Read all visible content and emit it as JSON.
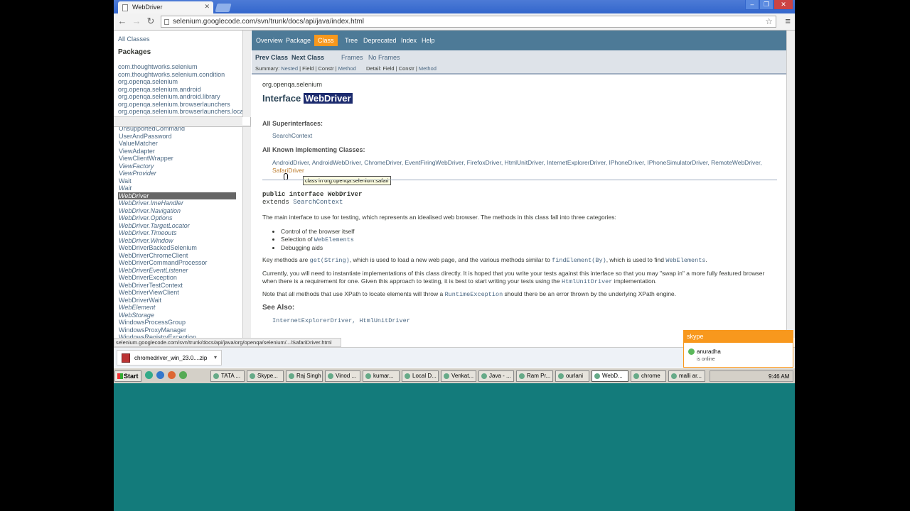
{
  "browser": {
    "tab_title": "WebDriver",
    "url": "selenium.googlecode.com/svn/trunk/docs/api/java/index.html"
  },
  "left_top": {
    "all_classes": "All Classes",
    "packages_heading": "Packages",
    "packages": [
      "com.thoughtworks.selenium",
      "com.thoughtworks.selenium.condition",
      "org.openqa.selenium",
      "org.openqa.selenium.android",
      "org.openqa.selenium.android.library",
      "org.openqa.selenium.browserlaunchers",
      "org.openqa.selenium.browserlaunchers.loca"
    ]
  },
  "class_list": [
    {
      "name": "UnsupportedCommand",
      "italic": false
    },
    {
      "name": "UserAndPassword",
      "italic": false
    },
    {
      "name": "ValueMatcher",
      "italic": false
    },
    {
      "name": "ViewAdapter",
      "italic": false
    },
    {
      "name": "ViewClientWrapper",
      "italic": false
    },
    {
      "name": "ViewFactory",
      "italic": true
    },
    {
      "name": "ViewProvider",
      "italic": true
    },
    {
      "name": "Wait",
      "italic": false
    },
    {
      "name": "Wait",
      "italic": true
    },
    {
      "name": "WebDriver",
      "italic": true,
      "selected": true
    },
    {
      "name": "WebDriver.ImeHandler",
      "italic": true
    },
    {
      "name": "WebDriver.Navigation",
      "italic": true
    },
    {
      "name": "WebDriver.Options",
      "italic": true
    },
    {
      "name": "WebDriver.TargetLocator",
      "italic": true
    },
    {
      "name": "WebDriver.Timeouts",
      "italic": true
    },
    {
      "name": "WebDriver.Window",
      "italic": true
    },
    {
      "name": "WebDriverBackedSelenium",
      "italic": false
    },
    {
      "name": "WebDriverChromeClient",
      "italic": false
    },
    {
      "name": "WebDriverCommandProcessor",
      "italic": false
    },
    {
      "name": "WebDriverEventListener",
      "italic": true
    },
    {
      "name": "WebDriverException",
      "italic": false
    },
    {
      "name": "WebDriverTestContext",
      "italic": false
    },
    {
      "name": "WebDriverViewClient",
      "italic": false
    },
    {
      "name": "WebDriverWait",
      "italic": false
    },
    {
      "name": "WebElement",
      "italic": true
    },
    {
      "name": "WebStorage",
      "italic": true
    },
    {
      "name": "WindowsProcessGroup",
      "italic": false
    },
    {
      "name": "WindowsProxyManager",
      "italic": false
    },
    {
      "name": "WindowsRegistryException",
      "italic": false
    }
  ],
  "topnav": {
    "overview": "Overview",
    "package": "Package",
    "class": "Class",
    "tree": "Tree",
    "deprecated": "Deprecated",
    "index": "Index",
    "help": "Help"
  },
  "subnav": {
    "prev_class": "Prev Class",
    "next_class": "Next Class",
    "frames": "Frames",
    "no_frames": "No Frames",
    "summary_label": "Summary: ",
    "summary_nested": "Nested",
    "summary_rest": " | Field | Constr | ",
    "summary_method": "Method",
    "detail_label": "Detail: Field | Constr | ",
    "detail_method": "Method"
  },
  "content": {
    "package": "org.openqa.selenium",
    "title_prefix": "Interface ",
    "title_name": "WebDriver",
    "superinterfaces_label": "All Superinterfaces:",
    "superinterfaces": "SearchContext",
    "impl_label": "All Known Implementing Classes:",
    "impl_classes": "AndroidDriver, AndroidWebDriver, ChromeDriver, EventFiringWebDriver, FirefoxDriver, HtmlUnitDriver, InternetExplorerDriver, IPhoneDriver, IPhoneSimulatorDriver, RemoteWebDriver,",
    "impl_last": "SafariDriver",
    "tooltip": "class in org.openqa.selenium.safari",
    "decl_line1": "public interface WebDriver",
    "decl_line2a": "extends ",
    "decl_line2b": "SearchContext",
    "main_desc": "The main interface to use for testing, which represents an idealised web browser. The methods in this class fall into three categories:",
    "bullets": [
      "Control of the browser itself",
      "Selection of ",
      "Debugging aids"
    ],
    "bullet2_code": "WebElements",
    "key_a": "Key methods are ",
    "key_b": "get(String)",
    "key_c": ", which is used to load a new web page, and the various methods similar to ",
    "key_d": "findElement(By)",
    "key_e": ", which is used to find ",
    "key_f": "WebElements",
    "key_g": ".",
    "curr_a": "Currently, you will need to instantiate implementations of this class directly. It is hoped that you write your tests against this interface so that you may \"swap in\" a more fully featured browser when there is a requirement for one. Given this approach to testing, it is best to start writing your tests using the ",
    "curr_b": "HtmlUnitDriver",
    "curr_c": " implementation.",
    "note_a": "Note that all methods that use XPath to locate elements will throw a ",
    "note_b": "RuntimeException",
    "note_c": " should there be an error thrown by the underlying XPath engine.",
    "see_also_label": "See Also:",
    "see_also": "InternetExplorerDriver, HtmlUnitDriver"
  },
  "status_url": "selenium.googlecode.com/svn/trunk/docs/api/java/org/openqa/selenium/.../SafariDriver.html",
  "download": "chromedriver_win_23.0....zip",
  "skype": {
    "title": "skype",
    "name": "anuradha",
    "status": "is online"
  },
  "taskbar": {
    "start": "Start",
    "items": [
      "TATA ...",
      "Skype...",
      "Raj Singh",
      "Vinod ...",
      "kumar...",
      "Local D...",
      "Venkat...",
      "Java - ...",
      "Ram Pr...",
      "ourlani",
      "WebD...",
      "chrome",
      "malli ar..."
    ],
    "active_index": 10,
    "time": "9:46 AM"
  }
}
